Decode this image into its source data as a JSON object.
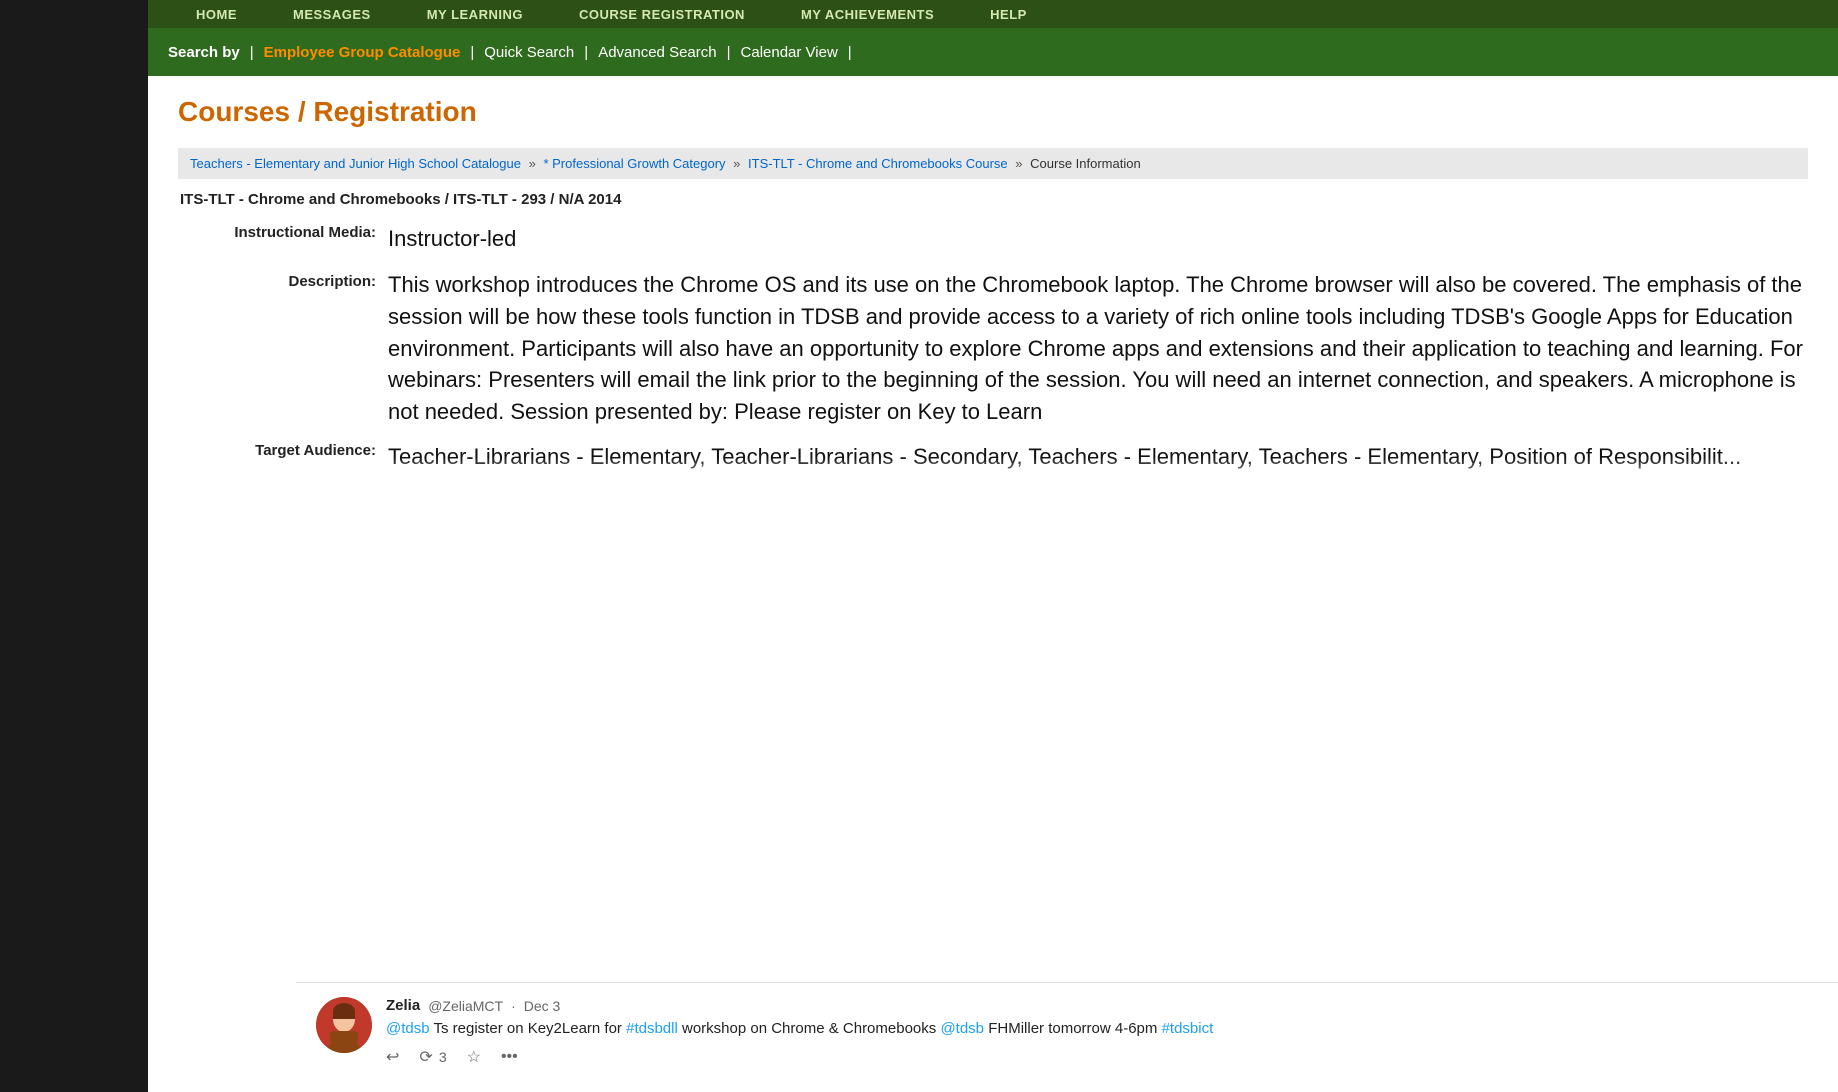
{
  "leftPanel": {
    "background": "#1a1a1a"
  },
  "topNav": {
    "items": [
      {
        "label": "HOME",
        "id": "home"
      },
      {
        "label": "MESSAGES",
        "id": "messages"
      },
      {
        "label": "MY LEARNING",
        "id": "my-learning"
      },
      {
        "label": "COURSE REGISTRATION",
        "id": "course-registration"
      },
      {
        "label": "MY ACHIEVEMENTS",
        "id": "my-achievements"
      },
      {
        "label": "HELP",
        "id": "help"
      }
    ]
  },
  "searchBar": {
    "label": "Search by",
    "separator": "|",
    "links": [
      {
        "label": "Employee Group Catalogue",
        "active": true,
        "id": "employee-group-catalogue"
      },
      {
        "label": "Quick Search",
        "active": false,
        "id": "quick-search"
      },
      {
        "label": "Advanced Search",
        "active": false,
        "id": "advanced-search"
      },
      {
        "label": "Calendar View",
        "active": false,
        "id": "calendar-view"
      }
    ]
  },
  "pageTitle": "Courses / Registration",
  "breadcrumb": {
    "parts": [
      {
        "label": "Teachers - Elementary and Junior High School Catalogue",
        "link": true
      },
      {
        "label": "* Professional Growth Category",
        "link": true
      },
      {
        "label": "ITS-TLT - Chrome and Chromebooks Course",
        "link": true
      },
      {
        "label": "Course Information",
        "link": false
      }
    ]
  },
  "courseTitle": "ITS-TLT - Chrome and Chromebooks / ITS-TLT - 293 / N/A 2014",
  "courseDetails": {
    "instructionalMediaLabel": "Instructional Media:",
    "instructionalMediaValue": "Instructor-led",
    "descriptionLabel": "Description:",
    "descriptionValue": "This workshop introduces the Chrome OS and its use on the Chromebook laptop. The Chrome browser will also be covered. The emphasis of the session will be how these tools function in TDSB and provide access to a variety of rich online tools including TDSB's Google Apps for Education environment. Participants will also have an opportunity to explore Chrome apps and extensions and their application to teaching and learning. For webinars: Presenters will email the link prior to the beginning of the session. You will need an internet connection, and speakers. A microphone is not needed. Session presented by: Please register on Key to Learn",
    "targetAudienceLabel": "Target Audience:",
    "targetAudienceValue": "Teacher-Librarians - Elementary, Teacher-Librarians - Secondary, Teachers - Elementary, Teachers - Elementary, Position of Responsibilit..."
  },
  "tweet": {
    "authorName": "Zelia",
    "authorHandle": "@ZeliaMCT",
    "date": "Dec 3",
    "text": " Ts register on Key2Learn for  workshop on Chrome & Chromebooks  FHMiller tomorrow 4-6pm ",
    "mention1": "@tdsb",
    "hashtag1": "#tdsbdll",
    "mention2": "@tdsb",
    "hashtag2": "#tdsbict",
    "retweetCount": "3",
    "actions": {
      "reply": "reply",
      "retweet": "retweet",
      "favorite": "favorite",
      "more": "more"
    }
  }
}
